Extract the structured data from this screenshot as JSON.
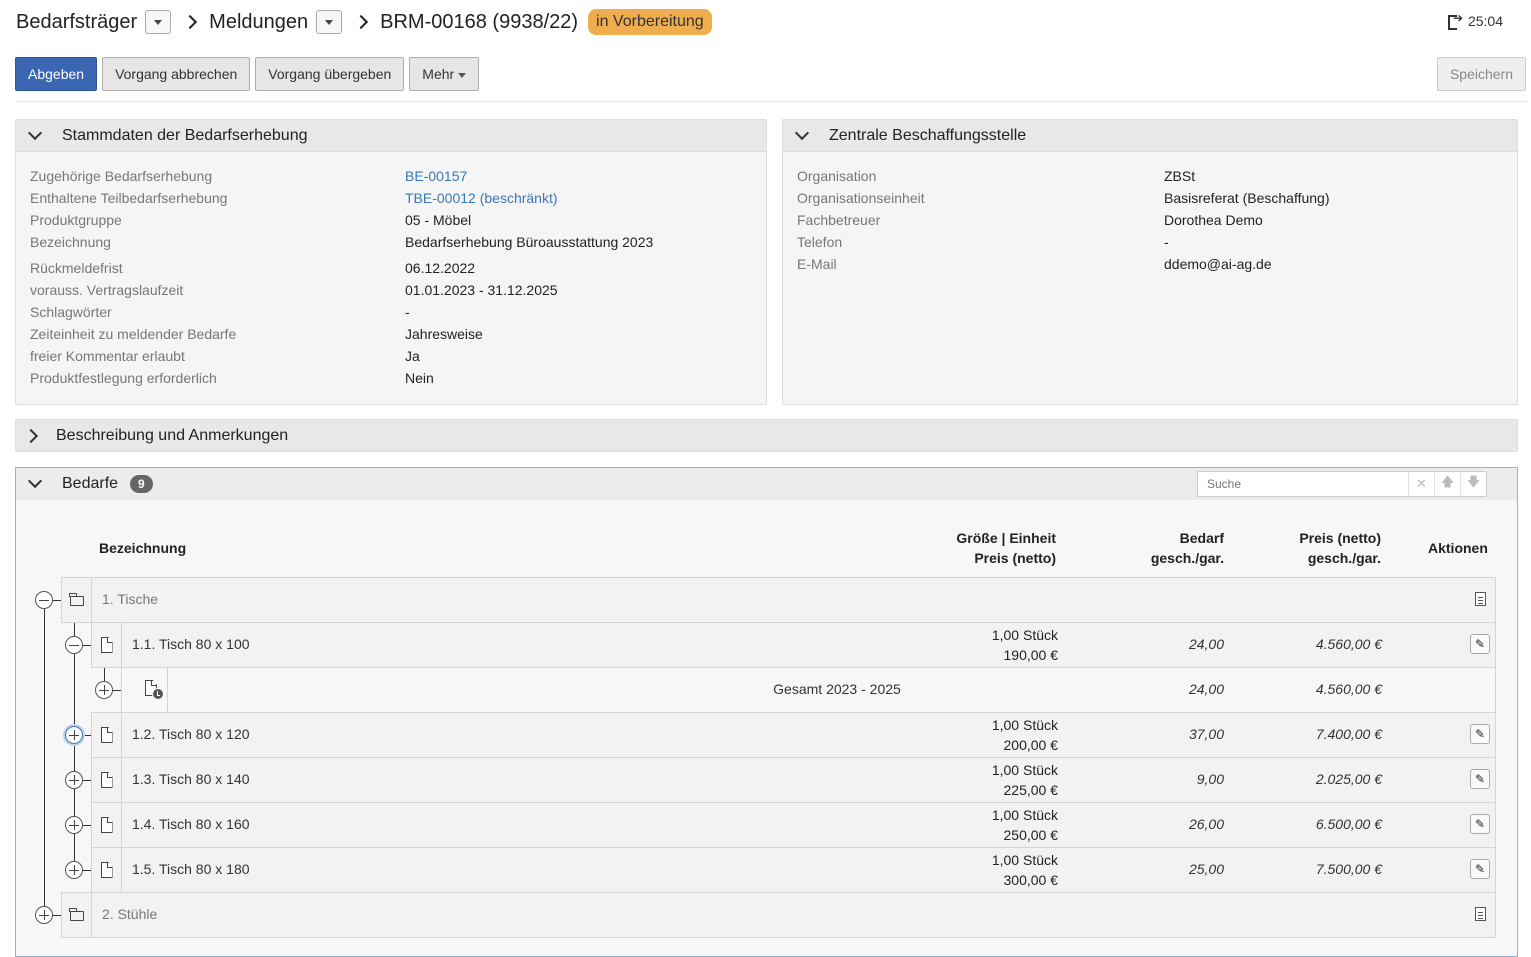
{
  "header": {
    "crumb1": "Bedarfsträger",
    "crumb2": "Meldungen",
    "crumb3": "BRM-00168 (9938/22)",
    "status": "in Vorbereitung",
    "timer": "25:04"
  },
  "toolbar": {
    "submit": "Abgeben",
    "cancel": "Vorgang abbrechen",
    "handover": "Vorgang übergeben",
    "more": "Mehr",
    "save": "Speichern"
  },
  "stammdaten": {
    "title": "Stammdaten der Bedarfserhebung",
    "rows": [
      {
        "label": "Zugehörige Bedarfserhebung",
        "value": "BE-00157"
      },
      {
        "label": "Enthaltene Teilbedarfserhebung",
        "value": "TBE-00012 (beschränkt)"
      },
      {
        "label": "Produktgruppe",
        "value": "05 - Möbel"
      },
      {
        "label": "Bezeichnung",
        "value": "Bedarfserhebung Büroausstattung 2023"
      },
      {
        "label": "Rückmeldefrist",
        "value": "06.12.2022"
      },
      {
        "label": "vorauss. Vertragslaufzeit",
        "value": "01.01.2023 - 31.12.2025"
      },
      {
        "label": "Schlagwörter",
        "value": "-"
      },
      {
        "label": "Zeiteinheit zu meldender Bedarfe",
        "value": "Jahresweise"
      },
      {
        "label": "freier Kommentar erlaubt",
        "value": "Ja"
      },
      {
        "label": "Produktfestlegung erforderlich",
        "value": "Nein"
      }
    ]
  },
  "zbs": {
    "title": "Zentrale Beschaffungsstelle",
    "rows": [
      {
        "label": "Organisation",
        "value": "ZBSt"
      },
      {
        "label": "Organisationseinheit",
        "value": "Basisreferat (Beschaffung)"
      },
      {
        "label": "Fachbetreuer",
        "value": "Dorothea Demo"
      },
      {
        "label": "Telefon",
        "value": "-"
      },
      {
        "label": "E-Mail",
        "value": "ddemo@ai-ag.de"
      }
    ]
  },
  "beschreibung": {
    "title": "Beschreibung und Anmerkungen"
  },
  "bedarfe": {
    "title": "Bedarfe",
    "count": "9",
    "search_placeholder": "Suche",
    "columns": {
      "name": "Bezeichnung",
      "size_line1": "Größe | Einheit",
      "size_line2": "Preis (netto)",
      "need_line1": "Bedarf",
      "need_line2": "gesch./gar.",
      "price_line1": "Preis (netto)",
      "price_line2": "gesch./gar.",
      "actions": "Aktionen"
    },
    "rows": [
      {
        "label": "1. Tische"
      },
      {
        "label": "1.1. Tisch 80 x 100",
        "qty": "1,00 Stück",
        "unit_price": "190,00 €",
        "need": "24,00",
        "total": "4.560,00 €"
      },
      {
        "label": "Gesamt 2023 - 2025",
        "need": "24,00",
        "total": "4.560,00 €"
      },
      {
        "label": "1.2. Tisch 80 x 120",
        "qty": "1,00 Stück",
        "unit_price": "200,00 €",
        "need": "37,00",
        "total": "7.400,00 €"
      },
      {
        "label": "1.3. Tisch 80 x 140",
        "qty": "1,00 Stück",
        "unit_price": "225,00 €",
        "need": "9,00",
        "total": "2.025,00 €"
      },
      {
        "label": "1.4. Tisch 80 x 160",
        "qty": "1,00 Stück",
        "unit_price": "250,00 €",
        "need": "26,00",
        "total": "6.500,00 €"
      },
      {
        "label": "1.5. Tisch 80 x 180",
        "qty": "1,00 Stück",
        "unit_price": "300,00 €",
        "need": "25,00",
        "total": "7.500,00 €"
      },
      {
        "label": "2. Stühle"
      }
    ]
  }
}
